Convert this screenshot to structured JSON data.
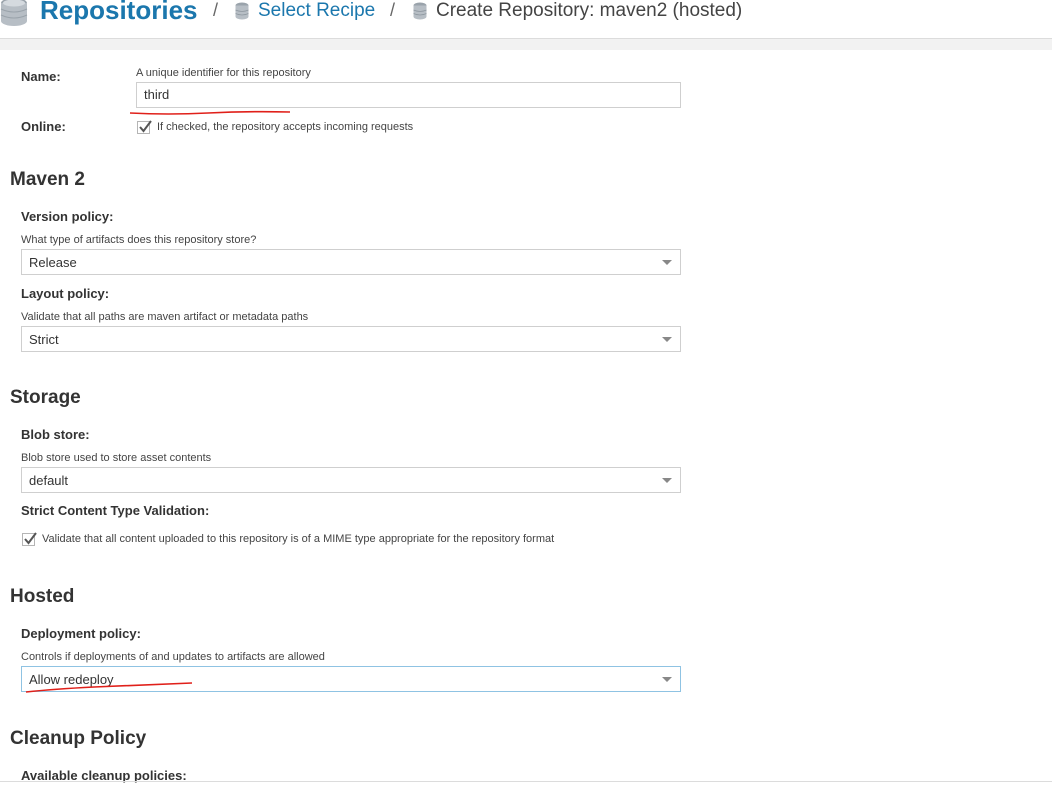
{
  "breadcrumb": {
    "root": "Repositories",
    "separator": "/",
    "step1": "Select Recipe",
    "step2": "Create Repository: maven2 (hosted)"
  },
  "name_field": {
    "label": "Name:",
    "help": "A unique identifier for this repository",
    "value": "third"
  },
  "online_field": {
    "label": "Online:",
    "checked": true,
    "help": "If checked, the repository accepts incoming requests"
  },
  "maven2": {
    "heading": "Maven 2",
    "version_policy": {
      "label": "Version policy:",
      "help": "What type of artifacts does this repository store?",
      "value": "Release"
    },
    "layout_policy": {
      "label": "Layout policy:",
      "help": "Validate that all paths are maven artifact or metadata paths",
      "value": "Strict"
    }
  },
  "storage": {
    "heading": "Storage",
    "blob_store": {
      "label": "Blob store:",
      "help": "Blob store used to store asset contents",
      "value": "default"
    },
    "strict_content": {
      "label": "Strict Content Type Validation:",
      "checked": true,
      "help": "Validate that all content uploaded to this repository is of a MIME type appropriate for the repository format"
    }
  },
  "hosted": {
    "heading": "Hosted",
    "deployment_policy": {
      "label": "Deployment policy:",
      "help": "Controls if deployments of and updates to artifacts are allowed",
      "value": "Allow redeploy"
    }
  },
  "cleanup": {
    "heading": "Cleanup Policy",
    "available_label": "Available cleanup policies:"
  },
  "colors": {
    "link": "#1b77ad",
    "annotation": "#e0201a",
    "focus_border": "#8fc3e3"
  }
}
